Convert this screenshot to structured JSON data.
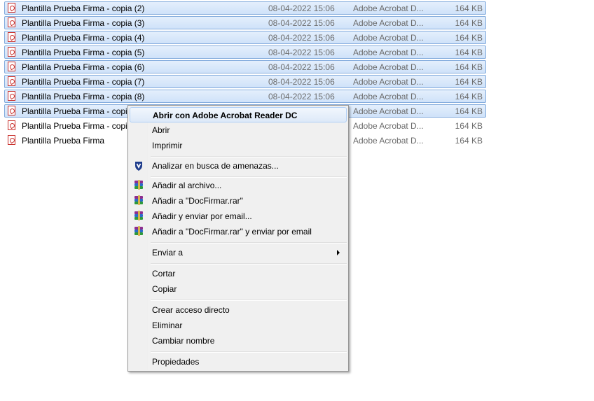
{
  "files": [
    {
      "name": "Plantilla Prueba Firma - copia (2)",
      "date": "08-04-2022 15:06",
      "type": "Adobe Acrobat D...",
      "size": "164 KB",
      "selected": true
    },
    {
      "name": "Plantilla Prueba Firma - copia (3)",
      "date": "08-04-2022 15:06",
      "type": "Adobe Acrobat D...",
      "size": "164 KB",
      "selected": true
    },
    {
      "name": "Plantilla Prueba Firma - copia (4)",
      "date": "08-04-2022 15:06",
      "type": "Adobe Acrobat D...",
      "size": "164 KB",
      "selected": true
    },
    {
      "name": "Plantilla Prueba Firma - copia (5)",
      "date": "08-04-2022 15:06",
      "type": "Adobe Acrobat D...",
      "size": "164 KB",
      "selected": true
    },
    {
      "name": "Plantilla Prueba Firma - copia (6)",
      "date": "08-04-2022 15:06",
      "type": "Adobe Acrobat D...",
      "size": "164 KB",
      "selected": true
    },
    {
      "name": "Plantilla Prueba Firma - copia (7)",
      "date": "08-04-2022 15:06",
      "type": "Adobe Acrobat D...",
      "size": "164 KB",
      "selected": true
    },
    {
      "name": "Plantilla Prueba Firma - copia (8)",
      "date": "08-04-2022 15:06",
      "type": "Adobe Acrobat D...",
      "size": "164 KB",
      "selected": true
    },
    {
      "name": "Plantilla Prueba Firma - copia",
      "date": "",
      "type": "Adobe Acrobat D...",
      "size": "164 KB",
      "selected": true
    },
    {
      "name": "Plantilla Prueba Firma - copia",
      "date": "",
      "type": "Adobe Acrobat D...",
      "size": "164 KB",
      "selected": false
    },
    {
      "name": "Plantilla Prueba Firma",
      "date": "",
      "type": "Adobe Acrobat D...",
      "size": "164 KB",
      "selected": false
    }
  ],
  "file_icon": "pdf-file-icon",
  "context_menu": {
    "open_with": "Abrir con Adobe Acrobat Reader DC",
    "open": "Abrir",
    "print": "Imprimir",
    "scan": "Analizar en busca de amenazas...",
    "scan_icon": "shield-icon",
    "add_archive": "Añadir al archivo...",
    "add_to_rar": "Añadir a \"DocFirmar.rar\"",
    "add_email": "Añadir y enviar por email...",
    "add_rar_email": "Añadir a \"DocFirmar.rar\" y enviar por email",
    "archive_icon": "winrar-icon",
    "send_to": "Enviar a",
    "cut": "Cortar",
    "copy": "Copiar",
    "create_shortcut": "Crear acceso directo",
    "delete": "Eliminar",
    "rename": "Cambiar nombre",
    "properties": "Propiedades"
  }
}
